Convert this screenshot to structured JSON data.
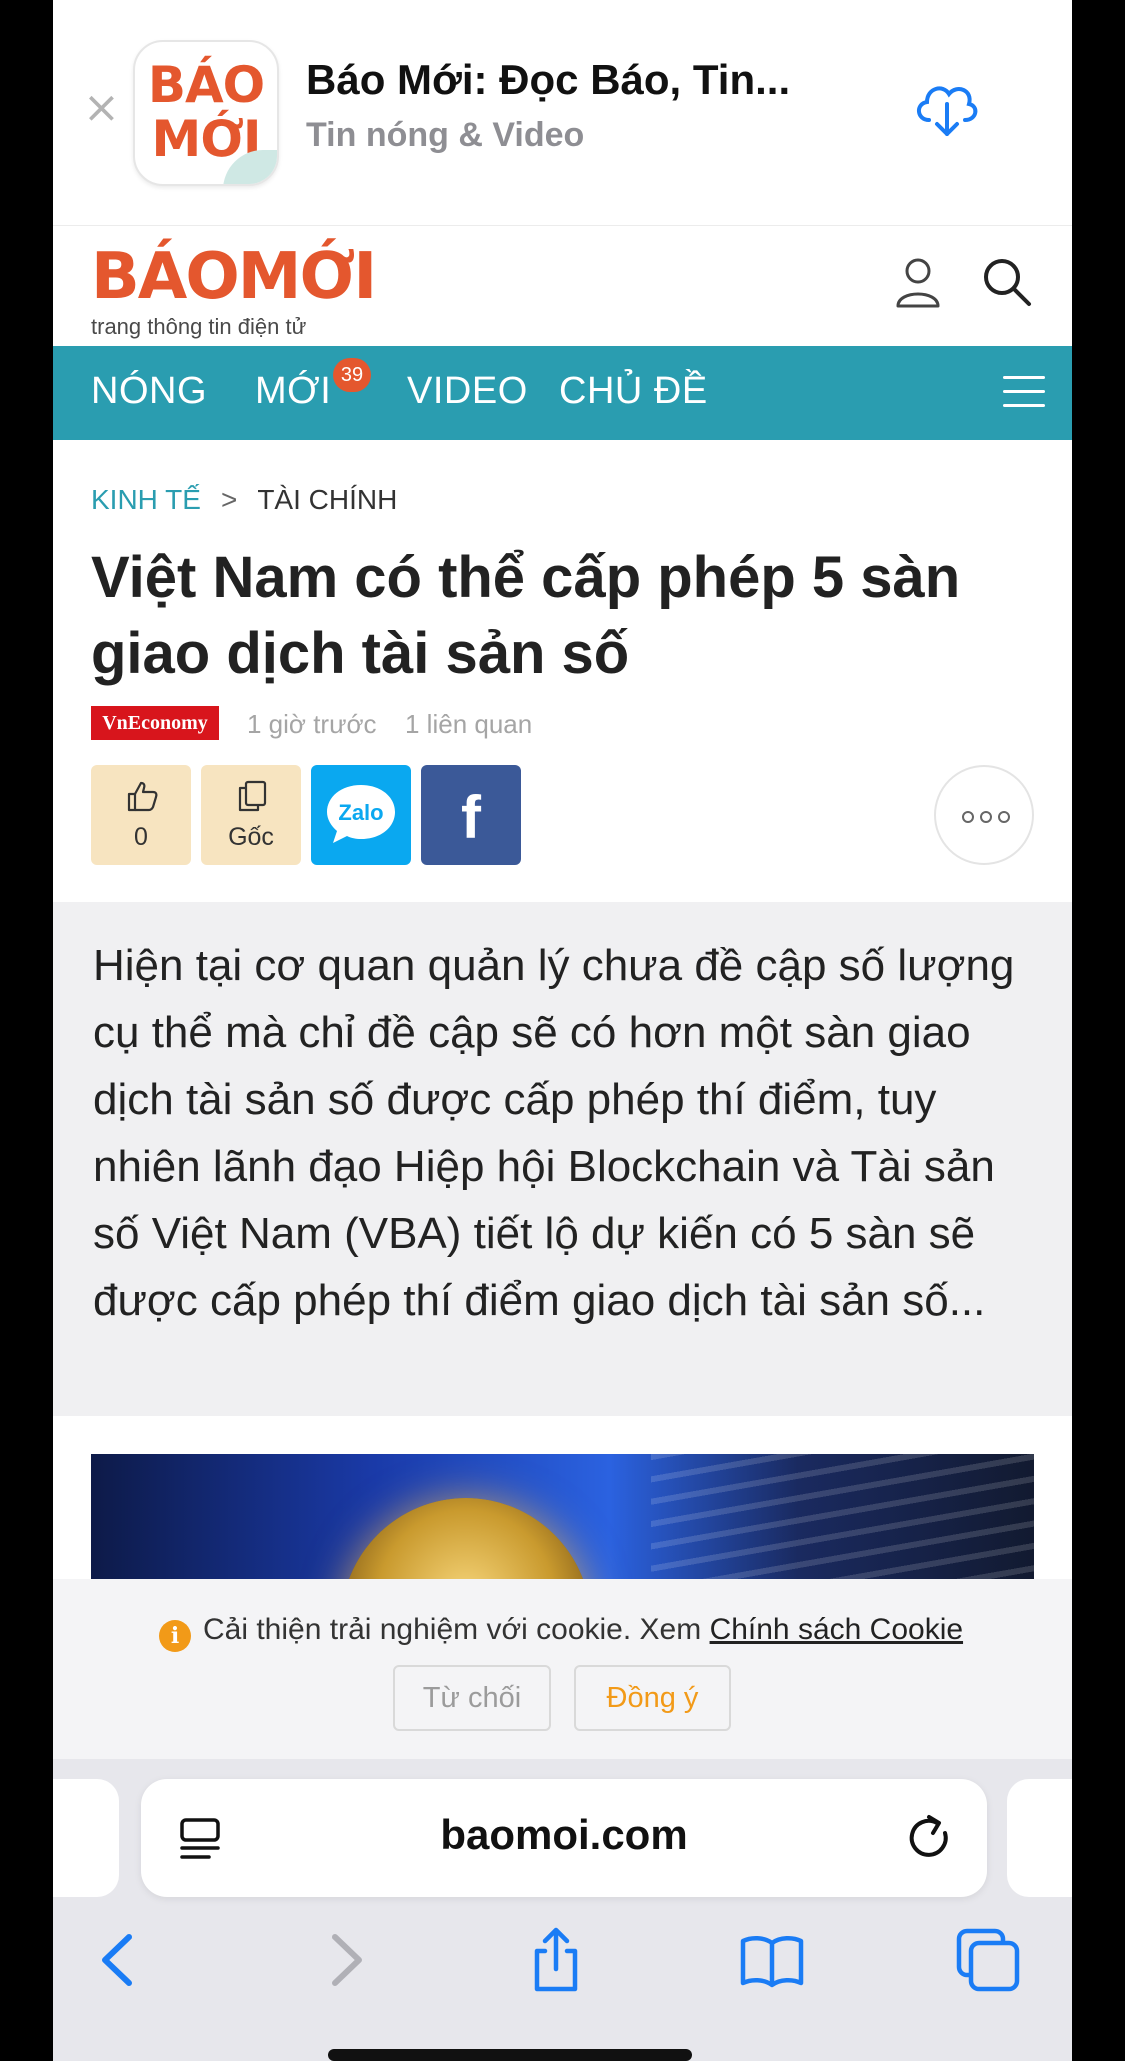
{
  "app_banner": {
    "close": "×",
    "icon_line1": "BÁO",
    "icon_line2": "MỚI",
    "title": "Báo Mới: Đọc Báo, Tin...",
    "subtitle": "Tin nóng & Video"
  },
  "site": {
    "logo": "BÁOMỚI",
    "tagline": "trang thông tin điện tử"
  },
  "nav": {
    "items": [
      "NÓNG",
      "MỚI",
      "VIDEO",
      "CHỦ ĐỀ"
    ],
    "new_badge": "39"
  },
  "article": {
    "breadcrumb_category": "KINH TẾ",
    "breadcrumb_separator": ">",
    "breadcrumb_sub": "TÀI CHÍNH",
    "title": "Việt Nam có thể cấp phép 5 sàn giao dịch tài sản số",
    "source": "VnEconomy",
    "time": "1 giờ trước",
    "related": "1 liên quan",
    "like_count": "0",
    "origin_label": "Gốc",
    "zalo_label": "Zalo",
    "facebook_label": "f",
    "summary": "Hiện tại cơ quan quản lý chưa đề cập số lượng cụ thể mà chỉ đề cập sẽ có hơn một sàn giao dịch tài sản số được cấp phép thí điểm, tuy nhiên lãnh đạo Hiệp hội Blockchain và Tài sản số Việt Nam (VBA) tiết lộ dự kiến có 5 sàn sẽ được cấp phép thí điểm giao dịch tài sản số..."
  },
  "cookie": {
    "message": "Cải thiện trải nghiệm với cookie. Xem ",
    "link": "Chính sách Cookie",
    "deny": "Từ chối",
    "accept": "Đồng ý"
  },
  "browser": {
    "url": "baomoi.com"
  },
  "colors": {
    "brand_teal": "#2a9db0",
    "brand_orange": "#e4572e",
    "accept_orange": "#f29a18",
    "ios_blue": "#1a7cf5"
  }
}
